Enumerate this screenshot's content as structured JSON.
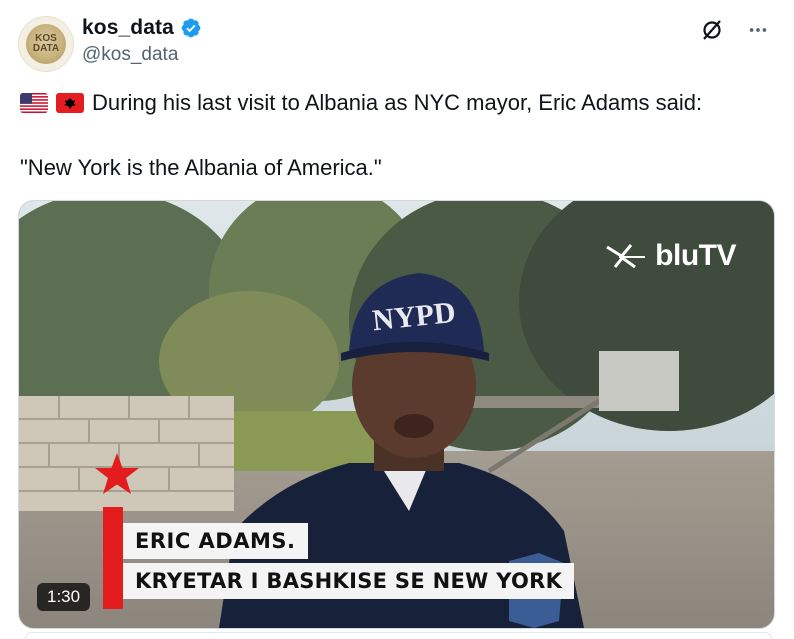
{
  "author": {
    "display_name": "kos_data",
    "handle": "@kos_data",
    "avatar_text": "KOS DATA"
  },
  "tweet": {
    "line1": "During his last visit to Albania as NYC mayor, Eric Adams said:",
    "line2": "\"New York is the Albania of America.\"",
    "flags": [
      "us-flag-icon",
      "albania-flag-icon"
    ]
  },
  "media": {
    "broadcaster": "bluTV",
    "caption_name": "ERIC ADAMS.",
    "caption_title": "KRYETAR I BASHKISE SE NEW YORK",
    "cap_text": "NYPD",
    "duration": "1:30"
  },
  "icons": {
    "grok": "grok-icon",
    "more": "more-options-icon",
    "verified": "verified-badge-icon"
  },
  "colors": {
    "verified_blue": "#1d9bf0",
    "text_primary": "#0f1419",
    "text_secondary": "#536471",
    "caption_red": "#e31d1d"
  }
}
